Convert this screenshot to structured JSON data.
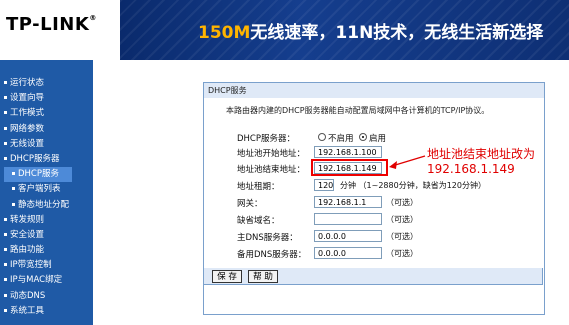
{
  "brand": {
    "logo": "TP-LINK",
    "reg": "®"
  },
  "banner": {
    "highlight": "150M",
    "rest": "无线速率，11N技术，无线生活新选择"
  },
  "nav": [
    {
      "label": "运行状态"
    },
    {
      "label": "设置向导"
    },
    {
      "label": "工作模式"
    },
    {
      "label": "网络参数"
    },
    {
      "label": "无线设置"
    },
    {
      "label": "DHCP服务器"
    },
    {
      "label": "DHCP服务"
    },
    {
      "label": "客户端列表"
    },
    {
      "label": "静态地址分配"
    },
    {
      "label": "转发规则"
    },
    {
      "label": "安全设置"
    },
    {
      "label": "路由功能"
    },
    {
      "label": "IP带宽控制"
    },
    {
      "label": "IP与MAC绑定"
    },
    {
      "label": "动态DNS"
    },
    {
      "label": "系统工具"
    }
  ],
  "panel": {
    "title": "DHCP服务",
    "description": "本路由器内建的DHCP服务器能自动配置局域网中各计算机的TCP/IP协议。",
    "dhcp_server_label": "DHCP服务器：",
    "disable_label": "不启用",
    "enable_label": "启用",
    "start_label": "地址池开始地址：",
    "start_value": "192.168.1.100",
    "end_label": "地址池结束地址：",
    "end_value": "192.168.1.149",
    "lease_label": "地址租期：",
    "lease_value": "120",
    "lease_hint": "分钟 （1~2880分钟，缺省为120分钟）",
    "gateway_label": "网关：",
    "gateway_value": "192.168.1.1",
    "optional": "（可选）",
    "domain_label": "缺省域名：",
    "domain_value": "",
    "dns1_label": "主DNS服务器：",
    "dns1_value": "0.0.0.0",
    "dns2_label": "备用DNS服务器：",
    "dns2_value": "0.0.0.0",
    "save_label": "保 存",
    "help_label": "帮 助"
  },
  "annotation": {
    "line1": "地址池结束地址改为",
    "line2": "192.168.1.149",
    "color": "#e00000"
  }
}
